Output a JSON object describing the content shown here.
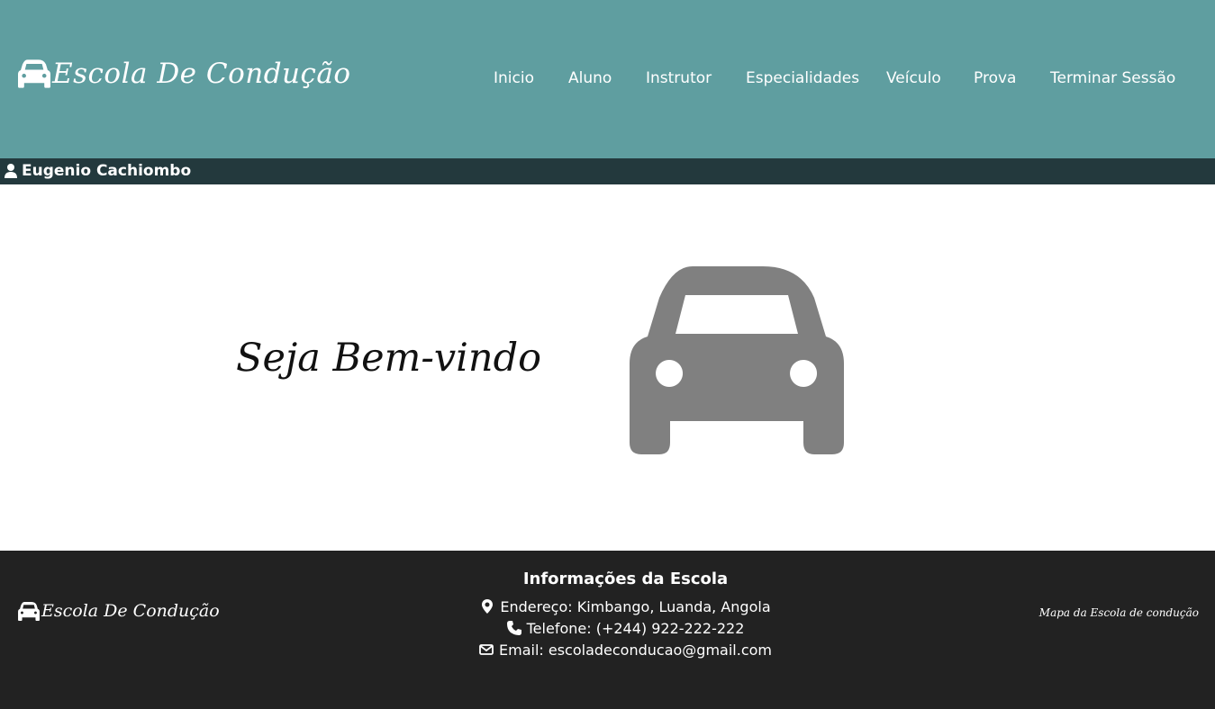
{
  "header": {
    "brand": "Escola De Condução",
    "brand_icon": "car-icon",
    "background": "#5f9ea0",
    "nav": [
      {
        "label": "Inicio",
        "name": "inicio"
      },
      {
        "label": "Aluno",
        "name": "aluno"
      },
      {
        "label": "Instrutor",
        "name": "instrutor"
      },
      {
        "label": "Especialidades",
        "name": "especialidades"
      },
      {
        "label": "Veículo",
        "name": "veiculo"
      },
      {
        "label": "Prova",
        "name": "prova"
      },
      {
        "label": "Terminar Sessão",
        "name": "terminar-sessao"
      }
    ]
  },
  "userbar": {
    "icon": "user-icon",
    "name": "Eugenio Cachiombo",
    "background": "#23393d"
  },
  "main": {
    "welcome": "Seja Bem-vindo",
    "hero_icon": "car-icon",
    "hero_color": "#808080"
  },
  "footer": {
    "background": "#222222",
    "brand": "Escola De Condução",
    "info_title": "Informações da Escola",
    "address": "Endereço: Kimbango, Luanda, Angola",
    "phone": "Telefone: (+244) 922-222-222",
    "email": "Email: escoladeconducao@gmail.com",
    "map_link": "Mapa da Escola de condução"
  }
}
